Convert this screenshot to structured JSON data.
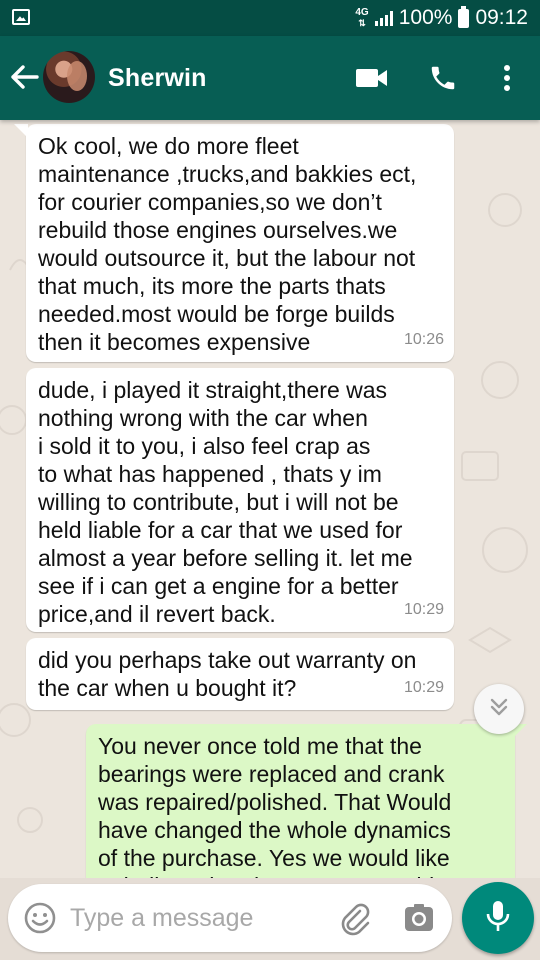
{
  "status_bar": {
    "network": "4G",
    "battery_percent": "100%",
    "time": "09:12",
    "icons": [
      "gallery-notification-icon",
      "network-4g-icon",
      "signal-icon",
      "battery-icon"
    ]
  },
  "header": {
    "contact_name": "Sherwin",
    "icons": [
      "back-arrow-icon",
      "video-call-icon",
      "phone-call-icon",
      "overflow-menu-icon"
    ]
  },
  "colors": {
    "app_bar": "#075e54",
    "status_bar": "#054d44",
    "incoming_bubble": "#ffffff",
    "outgoing_bubble": "#dcf8c6",
    "accent": "#00897b",
    "chat_background": "#ece5dd"
  },
  "messages": [
    {
      "direction": "incoming",
      "text": "Ok cool, we do more fleet\nmaintenance ,trucks,and bakkies ect,\nfor courier companies,so we don’t\nrebuild those engines ourselves.we\nwould outsource it, but the labour not\nthat much, its more the parts thats\nneeded.most would be forge builds\nthen it becomes expensive",
      "time": "10:26"
    },
    {
      "direction": "incoming",
      "text": "dude, i played it straight,there was\nnothing wrong with the car when\ni sold it to you, i also feel crap as\nto what has happened , thats y im\nwilling to contribute, but i will not be\nheld liable for a car that we used for\nalmost a year before selling it. let me\nsee if i can get a engine for a better\nprice,and il revert back.",
      "time": "10:29"
    },
    {
      "direction": "incoming",
      "text": "did you perhaps take out warranty on\nthe car when u bought it?",
      "time": "10:29"
    },
    {
      "direction": "outgoing",
      "text": "You never once told me that the\nbearings were replaced and crank\nwas repaired/polished. That Would\nhave changed the whole dynamics\nof the purchase. Yes we would like\nto believe that there was something",
      "time": ""
    }
  ],
  "composer": {
    "placeholder": "Type a message",
    "value": "",
    "icons": [
      "emoji-icon",
      "attach-icon",
      "camera-icon",
      "mic-icon"
    ]
  },
  "scroll_button": {
    "icon": "double-chevron-down-icon"
  }
}
